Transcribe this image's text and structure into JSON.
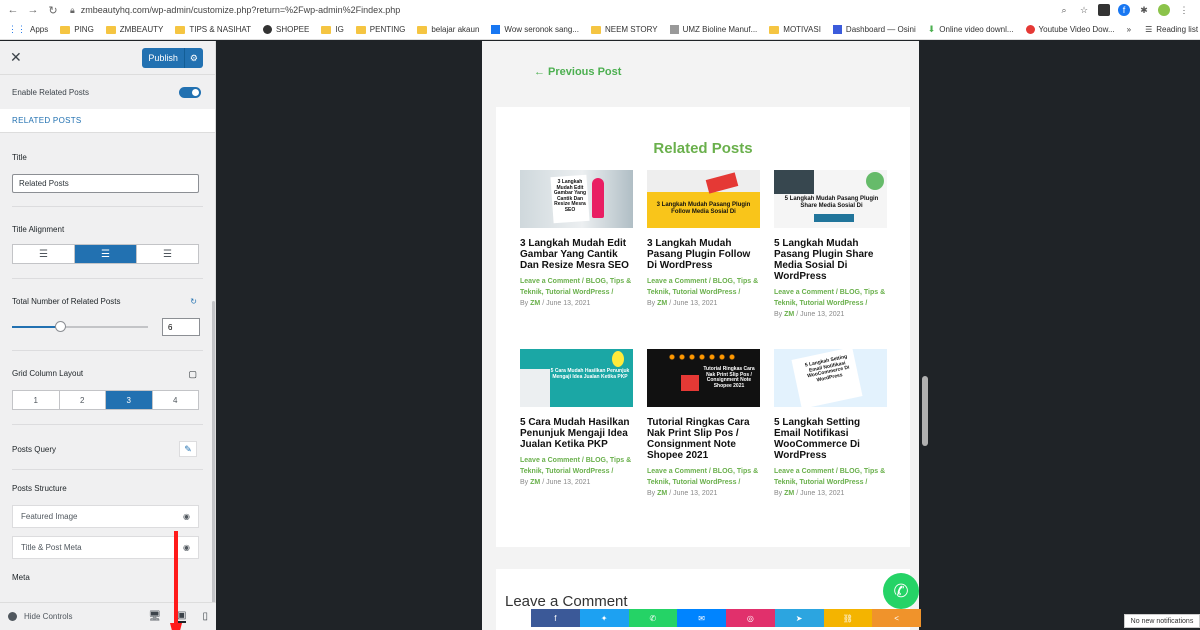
{
  "browser": {
    "url": "zmbeautyhq.com/wp-admin/customize.php?return=%2Fwp-admin%2Findex.php",
    "bookmarks": [
      "Apps",
      "PING",
      "ZMBEAUTY",
      "TIPS & NASIHAT",
      "SHOPEE",
      "IG",
      "PENTING",
      "belajar akaun",
      "Wow seronok sang...",
      "NEEM STORY",
      "UMZ Bioline Manuf...",
      "MOTIVASI",
      "Dashboard — Osini",
      "Online video downl...",
      "Youtube Video Dow..."
    ],
    "reading_list": "Reading list",
    "more": "»"
  },
  "customizer": {
    "publish_label": "Publish",
    "enable_label": "Enable Related Posts",
    "section_title": "RELATED POSTS",
    "title_label": "Title",
    "title_value": "Related Posts",
    "alignment_label": "Title Alignment",
    "total_label": "Total Number of Related Posts",
    "total_value": "6",
    "total_fraction": 0.35,
    "grid_label": "Grid Column Layout",
    "grid_options": [
      "1",
      "2",
      "3",
      "4"
    ],
    "grid_selected": "3",
    "query_label": "Posts Query",
    "structure_label": "Posts Structure",
    "structure_items": [
      "Featured Image",
      "Title & Post Meta"
    ],
    "meta_label": "Meta",
    "hide_controls": "Hide Controls",
    "accent": "#2271b1"
  },
  "preview": {
    "previous_post": "← Previous Post",
    "related_title": "Related Posts",
    "posts": [
      {
        "title": "3 Langkah Mudah Edit Gambar Yang Cantik Dan Resize Mesra SEO",
        "thumb_caption": "3 Langkah Mudah Edit Gambar Yang Cantik Dan Resize Mesra SEO",
        "meta": "Leave a Comment / BLOG, Tips & Teknik, Tutorial WordPress /",
        "by": "By",
        "author": "ZM",
        "date": "/ June 13, 2021"
      },
      {
        "title": "3 Langkah Mudah Pasang Plugin Follow Di WordPress",
        "thumb_caption": "3 Langkah Mudah Pasang Plugin Follow Media Sosial Di",
        "meta": "Leave a Comment / BLOG, Tips & Teknik, Tutorial WordPress /",
        "by": "By",
        "author": "ZM",
        "date": "/ June 13, 2021"
      },
      {
        "title": "5 Langkah Mudah Pasang Plugin Share Media Sosial Di WordPress",
        "thumb_caption": "5 Langkah Mudah Pasang Plugin Share Media Sosial Di",
        "meta": "Leave a Comment / BLOG, Tips & Teknik, Tutorial WordPress /",
        "by": "By",
        "author": "ZM",
        "date": "/ June 13, 2021"
      },
      {
        "title": "5 Cara Mudah Hasilkan Penunjuk Mengaji Idea Jualan Ketika PKP",
        "thumb_caption": "5 Cara Mudah Hasilkan Penunjuk Mengaji Idea Jualan Ketika PKP",
        "meta": "Leave a Comment / BLOG, Tips & Teknik, Tutorial WordPress /",
        "by": "By",
        "author": "ZM",
        "date": "/ June 13, 2021"
      },
      {
        "title": "Tutorial Ringkas Cara Nak Print Slip Pos / Consignment Note Shopee 2021",
        "thumb_caption": "Tutorial Ringkas Cara Nak Print Slip Pos / Consignment Note Shopee 2021",
        "meta": "Leave a Comment / BLOG, Tips & Teknik, Tutorial WordPress /",
        "by": "By",
        "author": "ZM",
        "date": "/ June 13, 2021"
      },
      {
        "title": "5 Langkah Setting Email Notifikasi WooCommerce Di WordPress",
        "thumb_caption": "5 Langkah Setting Email Notifikasi WooCommerce Di WordPress",
        "meta": "Leave a Comment / BLOG, Tips & Teknik, Tutorial WordPress /",
        "by": "By",
        "author": "ZM",
        "date": "/ June 13, 2021"
      }
    ],
    "leave_comment": "Leave a Comment",
    "share_colors": [
      "#3b5998",
      "#1da1f2",
      "#25d366",
      "#0084ff",
      "#e1306c",
      "#2ca5e0",
      "#f4b400",
      "#f0932b",
      "#f0932b"
    ],
    "notification": "No new notifications"
  }
}
